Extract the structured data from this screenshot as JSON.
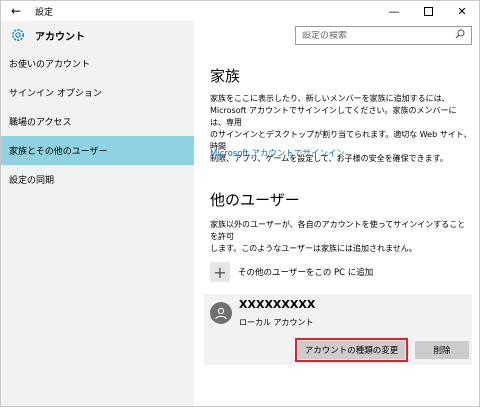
{
  "window": {
    "title": "設定",
    "back_icon": "back-arrow-icon",
    "controls": [
      "minimize",
      "maximize",
      "close"
    ]
  },
  "sidebar": {
    "title": "アカウント",
    "icon": "gear-icon",
    "items": [
      {
        "label": "お使いのアカウント",
        "active": false
      },
      {
        "label": "サインイン オプション",
        "active": false
      },
      {
        "label": "職場のアクセス",
        "active": false
      },
      {
        "label": "家族とその他のユーザー",
        "active": true
      },
      {
        "label": "設定の同期",
        "active": false
      }
    ],
    "active_color": "#8fd3e3"
  },
  "search": {
    "placeholder": "設定の検索"
  },
  "main": {
    "family": {
      "heading": "家族",
      "lines": [
        "家族をここに表示したり、新しいメンバーを家族に追加するには、",
        "Microsoft アカウントでサインインしてください。家族のメンバーには、専用",
        "のサインインとデスクトップが割り当てられます。適切な Web サイト、時間",
        "制限、アプリ、ゲームを設定して、お子様の安全を確保できます。"
      ],
      "link": "Microsoft アカウントでサインイン"
    },
    "others": {
      "heading": "他のユーザー",
      "lines": [
        "家族以外のユーザーが、各自のアカウントを使ってサインインすることを許可",
        "します。このようなユーザーは家族には追加されません。"
      ],
      "add_label": "その他のユーザーをこの PC に追加"
    },
    "user": {
      "name": "XXXXXXXXX",
      "type": "ローカル アカウント",
      "change_button": "アカウントの種類の変更",
      "delete_button": "削除"
    }
  },
  "colors": {
    "link": "#0a6fc2",
    "highlight": "#e0202b"
  }
}
